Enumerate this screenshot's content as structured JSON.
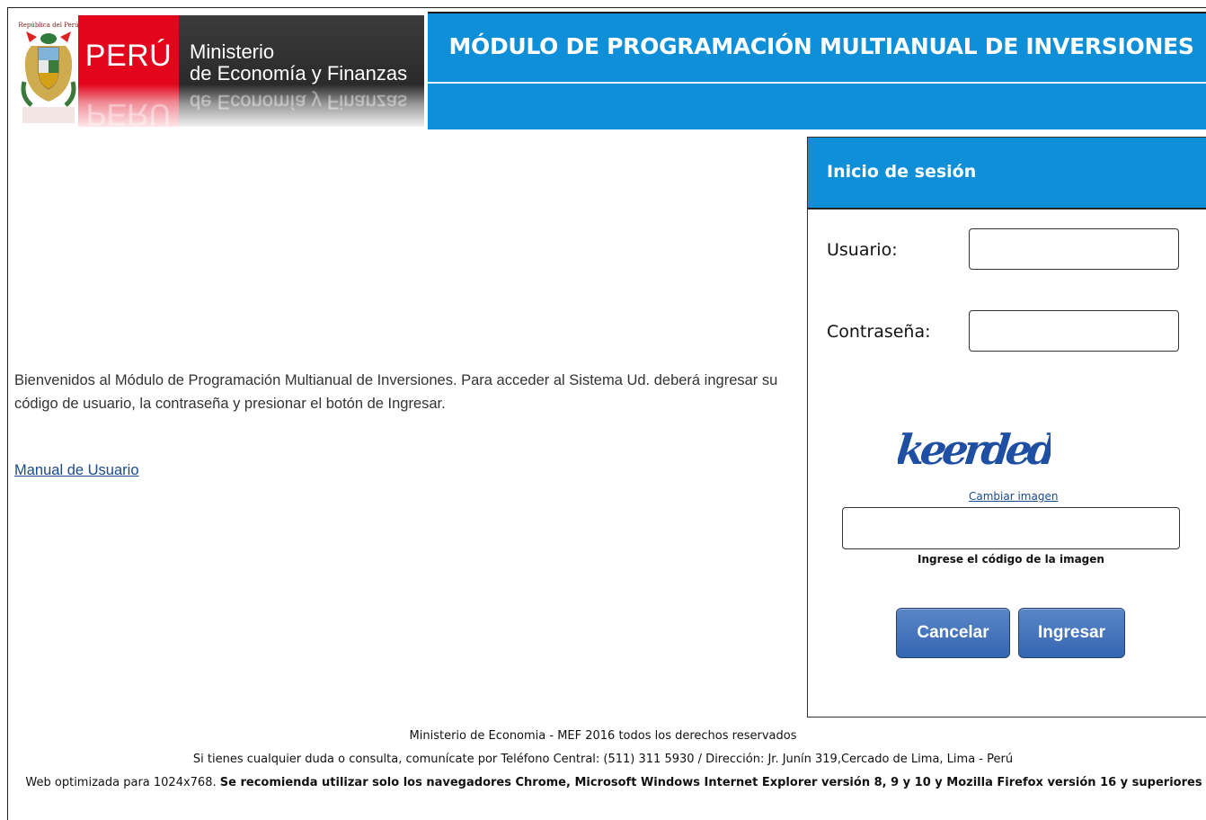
{
  "header": {
    "republic_text": "República del Perú",
    "country": "PERÚ",
    "ministry_line1": "Ministerio",
    "ministry_line2": "de Economía y Finanzas",
    "app_title": "MÓDULO DE PROGRAMACIÓN MULTIANUAL DE INVERSIONES"
  },
  "main": {
    "welcome_text": "Bienvenidos al Módulo de Programación Multianual de Inversiones. Para acceder al Sistema Ud. deberá ingresar su código de usuario, la contraseña y presionar el botón de Ingresar.",
    "manual_link": "Manual de Usuario"
  },
  "login": {
    "title": "Inicio de sesión",
    "user_label": "Usuario:",
    "user_value": "",
    "password_label": "Contraseña:",
    "password_value": "",
    "captcha_text": "keerded",
    "change_image": "Cambiar imagen",
    "captcha_value": "",
    "captcha_hint": "Ingrese el código de la imagen",
    "cancel_label": "Cancelar",
    "submit_label": "Ingresar"
  },
  "footer": {
    "copyright": "Ministerio de Economia - MEF 2016 todos los derechos reservados",
    "contact": "Si tienes cualquier duda o consulta, comunícate por Teléfono Central: (511) 311 5930 / Dirección: Jr. Junín 319,Cercado de Lima, Lima - Perú",
    "optimized": "Web optimizada para 1024x768.",
    "browsers": "Se recomienda utilizar solo los navegadores Chrome, Microsoft Windows Internet Explorer versión 8, 9 y 10 y Mozilla Firefox versión 16 y superiores"
  },
  "colors": {
    "brand_blue": "#0f8fd8",
    "peru_red": "#e3051b",
    "button_blue": "#3566b2"
  }
}
